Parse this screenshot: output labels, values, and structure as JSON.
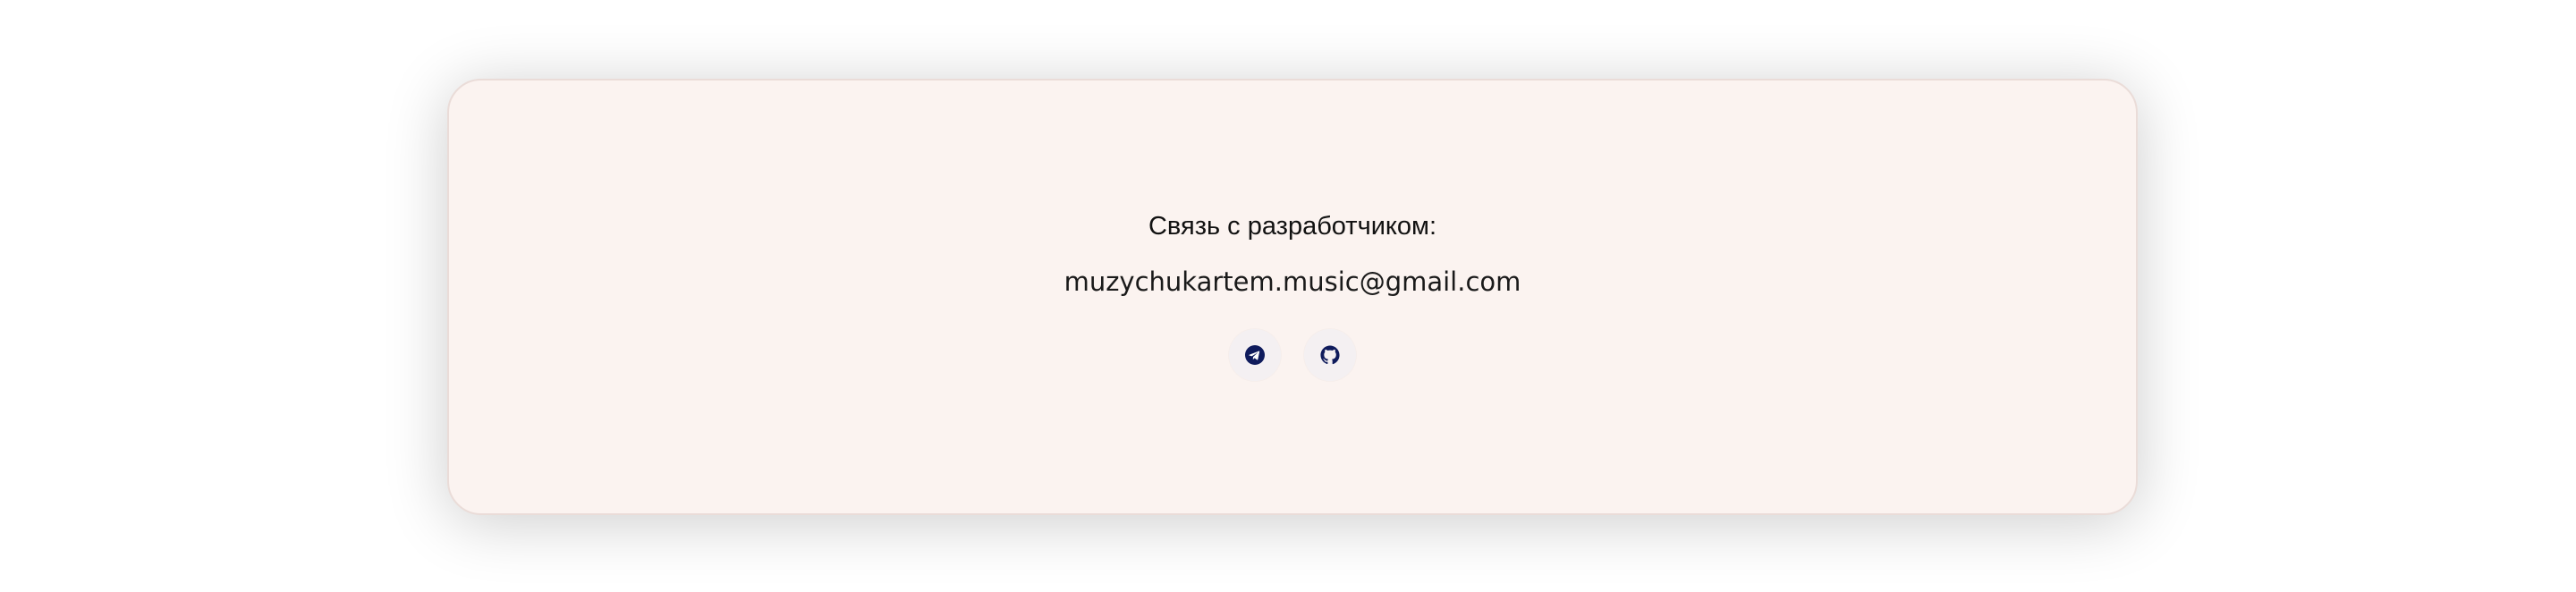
{
  "contact": {
    "title": "Связь с разработчиком:",
    "email": "muzychukartem.music@gmail.com",
    "social": [
      {
        "icon": "telegram-icon",
        "color": "#0f1b5c"
      },
      {
        "icon": "github-icon",
        "color": "#0f1b5c"
      }
    ]
  },
  "colors": {
    "card_background": "#fbf3f0",
    "icon_accent": "#0f1b5c"
  }
}
